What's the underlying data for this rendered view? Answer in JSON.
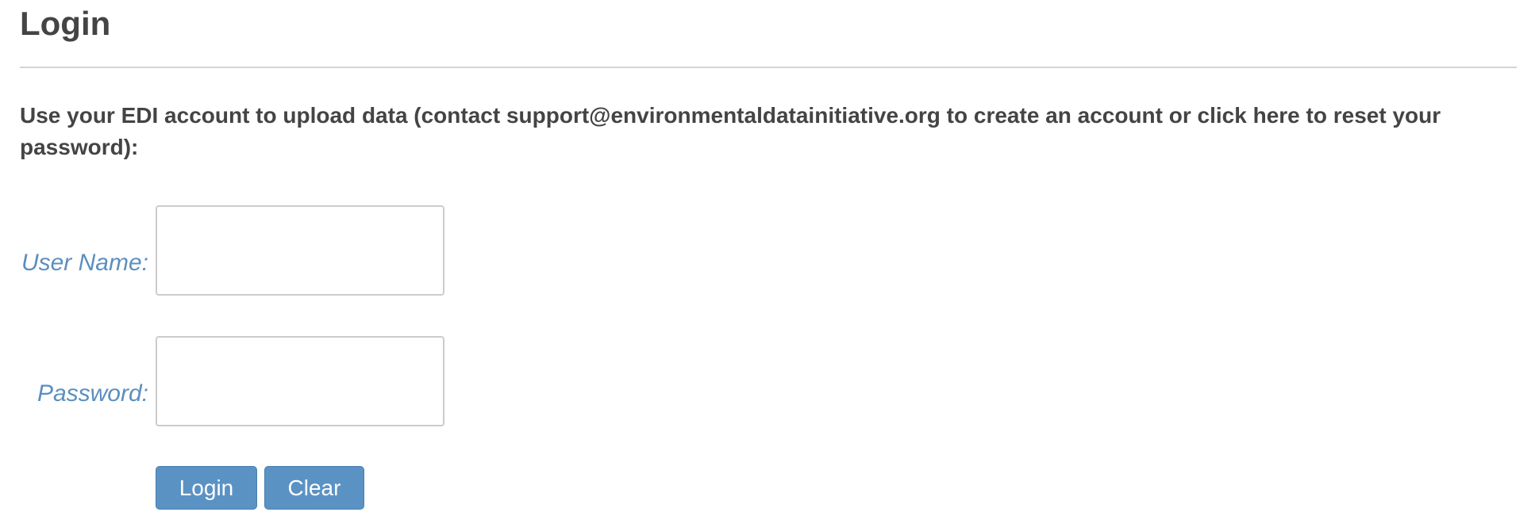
{
  "page": {
    "title": "Login"
  },
  "intro": {
    "prefix": "Use your EDI account to upload data (contact ",
    "email": "support@environmentaldatainitiative.org",
    "middle": " to create an account or ",
    "reset_link": "click here",
    "suffix": " to reset your password):"
  },
  "form": {
    "username_label": "User Name:",
    "username_value": "",
    "password_label": "Password:",
    "password_value": "",
    "login_button": "Login",
    "clear_button": "Clear"
  },
  "colors": {
    "text": "#444444",
    "label": "#5b8fbf",
    "button": "#5b92c4",
    "divider": "#d5d5d5"
  }
}
